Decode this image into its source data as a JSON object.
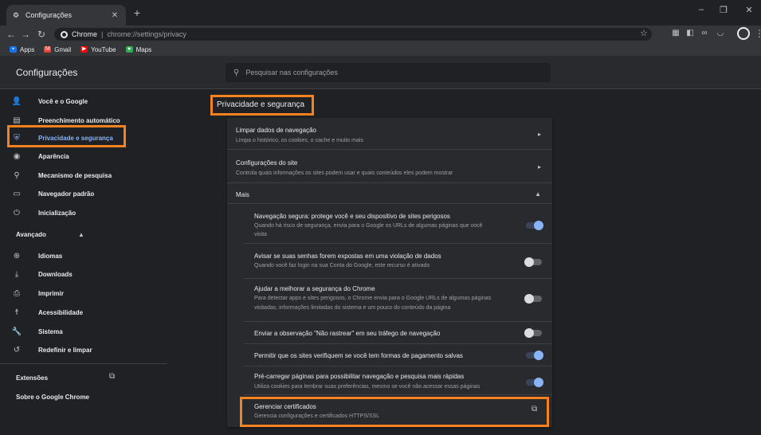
{
  "browser": {
    "tab_title": "Configurações",
    "tab_icon": "gear-icon",
    "omnibox": {
      "site_label": "Chrome",
      "separator": "|",
      "url_host": "chrome://",
      "url_path": "settings/privacy"
    },
    "bookmarks": [
      {
        "label": "Apps",
        "icon": "apps-grid-icon",
        "color": "#1a73e8"
      },
      {
        "label": "Gmail",
        "icon": "gmail-icon",
        "color": "#ea4335"
      },
      {
        "label": "YouTube",
        "icon": "youtube-icon",
        "color": "#ff0000"
      },
      {
        "label": "Maps",
        "icon": "maps-pin-icon",
        "color": "#34a853"
      }
    ]
  },
  "header": {
    "title": "Configurações",
    "search_placeholder": "Pesquisar nas configurações"
  },
  "sidebar": {
    "items": [
      {
        "label": "Você e o Google",
        "icon": "person-icon"
      },
      {
        "label": "Preenchimento automático",
        "icon": "autofill-icon"
      },
      {
        "label": "Privacidade e segurança",
        "icon": "shield-icon",
        "active": true
      },
      {
        "label": "Aparência",
        "icon": "palette-icon"
      },
      {
        "label": "Mecanismo de pesquisa",
        "icon": "search-icon"
      },
      {
        "label": "Navegador padrão",
        "icon": "browser-icon"
      },
      {
        "label": "Inicialização",
        "icon": "power-icon"
      }
    ],
    "advanced_label": "Avançado",
    "advanced_items": [
      {
        "label": "Idiomas",
        "icon": "globe-icon"
      },
      {
        "label": "Downloads",
        "icon": "download-icon"
      },
      {
        "label": "Imprimir",
        "icon": "printer-icon"
      },
      {
        "label": "Acessibilidade",
        "icon": "accessibility-icon"
      },
      {
        "label": "Sistema",
        "icon": "wrench-icon"
      },
      {
        "label": "Redefinir e limpar",
        "icon": "reset-icon"
      }
    ],
    "extensions_label": "Extensões",
    "about_label": "Sobre o Google Chrome"
  },
  "main": {
    "section_title": "Privacidade e segurança",
    "clear_data": {
      "title": "Limpar dados de navegação",
      "subtitle": "Limpa o histórico, os cookies, o cache e muito mais"
    },
    "site_settings": {
      "title": "Configurações do site",
      "subtitle": "Controla quais informações os sites podem usar e quais conteúdos eles podem mostrar"
    },
    "more_label": "Mais",
    "options": [
      {
        "title": "Navegação segura: protege você e seu dispositivo de sites perigosos",
        "subtitle1": "Quando há risco de segurança, envia para o Google os URLs de algumas páginas que você",
        "subtitle2": "visita",
        "enabled": true
      },
      {
        "title": "Avisar se suas senhas forem expostas em uma violação de dados",
        "subtitle1": "Quando você faz login na sua Conta do Google, este recurso é ativado",
        "subtitle2": "",
        "enabled": false
      },
      {
        "title": "Ajudar a melhorar a segurança do Chrome",
        "subtitle1": "Para detectar apps e sites perigosos, o Chrome envia para o Google URLs de algumas páginas",
        "subtitle2": "visitadas, informações limitadas do sistema e um pouco do conteúdo da página",
        "enabled": false
      },
      {
        "title": "Enviar a observação \"Não rastrear\" em seu tráfego de navegação",
        "subtitle1": "",
        "subtitle2": "",
        "enabled": false
      },
      {
        "title": "Permitir que os sites verifiquem se você tem formas de pagamento salvas",
        "subtitle1": "",
        "subtitle2": "",
        "enabled": true
      },
      {
        "title": "Pré-carregar páginas para possibilitar navegação e pesquisa mais rápidas",
        "subtitle1": "Utiliza cookies para lembrar suas preferências, mesmo se você não acessar essas páginas",
        "subtitle2": "",
        "enabled": true
      }
    ],
    "certificates": {
      "title": "Gerenciar certificados",
      "subtitle": "Gerencia configurações e certificados HTTPS/SSL"
    }
  },
  "colors": {
    "highlight": "#f5821f",
    "accent": "#8ab4f8"
  }
}
